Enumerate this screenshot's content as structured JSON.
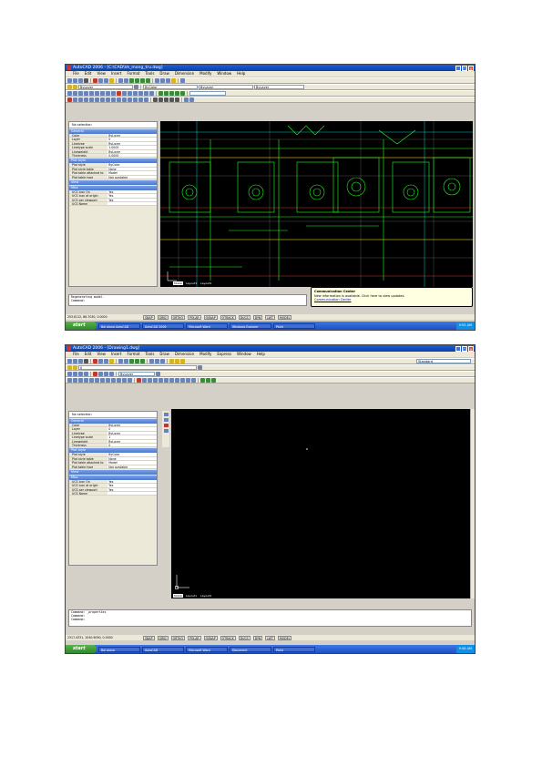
{
  "shot1": {
    "title": "AutoCAD 2006 - [C:\\CAD\\Ve_mong_tru.dwg]",
    "window_buttons": [
      "_",
      "□",
      "×"
    ],
    "menu": [
      "File",
      "Edit",
      "View",
      "Insert",
      "Format",
      "Tools",
      "Draw",
      "Dimension",
      "Modify",
      "Window",
      "Help"
    ],
    "layer_combo": "ByLayer",
    "linetype_combo": "ByLayer",
    "lineweight_combo": "ByLayer",
    "color_combo": "ByColor",
    "properties": {
      "selector": "No selection",
      "sections": [
        {
          "name": "General",
          "rows": [
            [
              "Color",
              "ByLayer"
            ],
            [
              "Layer",
              "0"
            ],
            [
              "Linetype",
              "ByLayer"
            ],
            [
              "Linetype scale",
              "1.0000"
            ],
            [
              "Lineweight",
              "ByLayer"
            ],
            [
              "Thickness",
              "0.0000"
            ]
          ]
        },
        {
          "name": "Plot style",
          "rows": [
            [
              "Plot style",
              "ByColor"
            ],
            [
              "Plot style table",
              "None"
            ],
            [
              "Plot table attached to",
              "Model"
            ],
            [
              "Plot table type",
              "Not available"
            ]
          ]
        },
        {
          "name": "View",
          "rows": []
        },
        {
          "name": "Misc",
          "rows": [
            [
              "UCS icon On",
              "Yes"
            ],
            [
              "UCS icon at origin",
              "Yes"
            ],
            [
              "UCS per viewport",
              "Yes"
            ],
            [
              "UCS Name",
              ""
            ]
          ]
        }
      ]
    },
    "tabs": [
      "Model",
      "Layout1",
      "Layout2"
    ],
    "command_lines": [
      "Regenerating model.",
      "Command:"
    ],
    "balloon": {
      "title": "Communication Center",
      "text": "New information is available. Click here to view updates.",
      "link": "Communication Center"
    },
    "status": {
      "coords": "253.8112, 86.7030, 0.0000",
      "toggles": [
        "SNAP",
        "GRID",
        "ORTHO",
        "POLAR",
        "OSNAP",
        "OTRACK",
        "DUCS",
        "DYN",
        "LWT",
        "MODEL"
      ]
    },
    "taskbar": {
      "start": "start",
      "buttons": [
        "Bai giang AutoCAD",
        "AutoCAD 2006",
        "Microsoft Word",
        "Windows Explorer",
        "Paint"
      ],
      "clock": "9:55 AM"
    }
  },
  "shot2": {
    "title": "AutoCAD 2006 - [Drawing1.dwg]",
    "window_buttons": [
      "_",
      "□",
      "×"
    ],
    "menu": [
      "File",
      "Edit",
      "View",
      "Insert",
      "Format",
      "Tools",
      "Draw",
      "Dimension",
      "Modify",
      "Express",
      "Window",
      "Help"
    ],
    "layer_combo": "0",
    "linetype_combo": "ByLayer",
    "style_combo": "Standard",
    "properties": {
      "selector": "No selection",
      "sections": [
        {
          "name": "General",
          "rows": [
            [
              "Color",
              "ByLayer"
            ],
            [
              "Layer",
              "0"
            ],
            [
              "Linetype",
              "ByLayer"
            ],
            [
              "Linetype scale",
              "1"
            ],
            [
              "Lineweight",
              "ByLayer"
            ],
            [
              "Thickness",
              "0"
            ]
          ]
        },
        {
          "name": "Plot style",
          "rows": [
            [
              "Plot style",
              "ByColor"
            ],
            [
              "Plot style table",
              "None"
            ],
            [
              "Plot table attached to",
              "Model"
            ],
            [
              "Plot table type",
              "Not available"
            ]
          ]
        },
        {
          "name": "View",
          "rows": []
        },
        {
          "name": "Misc",
          "rows": [
            [
              "UCS icon On",
              "Yes"
            ],
            [
              "UCS icon at origin",
              "Yes"
            ],
            [
              "UCS per viewport",
              "Yes"
            ],
            [
              "UCS Name",
              ""
            ]
          ]
        }
      ]
    },
    "tabs": [
      "Model",
      "Layout1",
      "Layout2"
    ],
    "command_lines": [
      "Command: _properties",
      "Command:",
      "Command:"
    ],
    "status": {
      "coords": "2317.4331, 1040.9090, 0.0000",
      "toggles": [
        "SNAP",
        "GRID",
        "ORTHO",
        "POLAR",
        "OSNAP",
        "OTRACK",
        "DUCS",
        "DYN",
        "LWT",
        "MODEL"
      ]
    },
    "taskbar": {
      "start": "start",
      "buttons": [
        "Bai giang",
        "AutoCAD",
        "Microsoft Word",
        "Document",
        "Paint"
      ],
      "clock": "9:58 AM"
    }
  }
}
